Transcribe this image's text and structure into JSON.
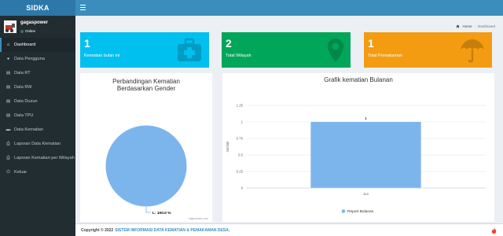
{
  "app": {
    "name": "SIDKA"
  },
  "user": {
    "name": "gagaspower",
    "status": "Online"
  },
  "sidebar": {
    "items": [
      {
        "label": "Dashboard",
        "icon": "home-icon",
        "glyph": "⌂",
        "active": true
      },
      {
        "label": "Data Pengguna",
        "icon": "user-icon",
        "glyph": "●"
      },
      {
        "label": "Data RT",
        "icon": "file-icon",
        "glyph": "▤"
      },
      {
        "label": "Data RW",
        "icon": "file-icon",
        "glyph": "▤"
      },
      {
        "label": "Data Dusun",
        "icon": "file-icon",
        "glyph": "▤"
      },
      {
        "label": "Data TPU",
        "icon": "file-icon",
        "glyph": "▤"
      },
      {
        "label": "Data Kematian",
        "icon": "folder-icon",
        "glyph": "▬"
      },
      {
        "label": "Laporan Data Kematian",
        "icon": "print-icon",
        "glyph": "⎙"
      },
      {
        "label": "Laporan Kematian per Wilayah",
        "icon": "print-icon",
        "glyph": "⎙"
      },
      {
        "label": "Keluar",
        "icon": "power-icon",
        "glyph": "⏻"
      }
    ]
  },
  "breadcrumb": {
    "home": "Home",
    "current": "Dashboard"
  },
  "stats": [
    {
      "value": "1",
      "label": "Kematian bulan ini",
      "icon": "medkit-icon",
      "color": "#00c0ef"
    },
    {
      "value": "2",
      "label": "Total Wilayah",
      "icon": "map-marker-icon",
      "color": "#00a65a"
    },
    {
      "value": "1",
      "label": "Total Pemakaman",
      "icon": "umbrella-icon",
      "color": "#f39c12"
    }
  ],
  "pie_panel": {
    "title": "Perbandingan Kematian Berdasarkan Gender",
    "credit": "Highcharts.com"
  },
  "bar_panel": {
    "title": "Grafik kematian Bulanan"
  },
  "chart_data": [
    {
      "type": "pie",
      "title": "Perbandingan Kematian Berdasarkan Gender",
      "slices": [
        {
          "label": "L",
          "value": 100.0,
          "display": "L: 100.0 %",
          "color": "#7cb5ec"
        }
      ]
    },
    {
      "type": "bar",
      "title": "Grafik kematian Bulanan",
      "categories": [
        "Jun"
      ],
      "series": [
        {
          "name": "Report Bulanan",
          "values": [
            1
          ],
          "color": "#7cb5ec"
        }
      ],
      "ylabel": "Jumlah",
      "ylim": [
        0,
        1.25
      ],
      "yticks": [
        "0",
        "0.25",
        "0.5",
        "0.75",
        "1",
        "1.25"
      ],
      "legend": "bottom",
      "grid": true
    }
  ],
  "footer": {
    "prefix": "Copyright © 2022",
    "link": "SISTEM INFORMASI DATA KEMATIAN & PEMAKAMAN DESA",
    "suffix": "."
  }
}
